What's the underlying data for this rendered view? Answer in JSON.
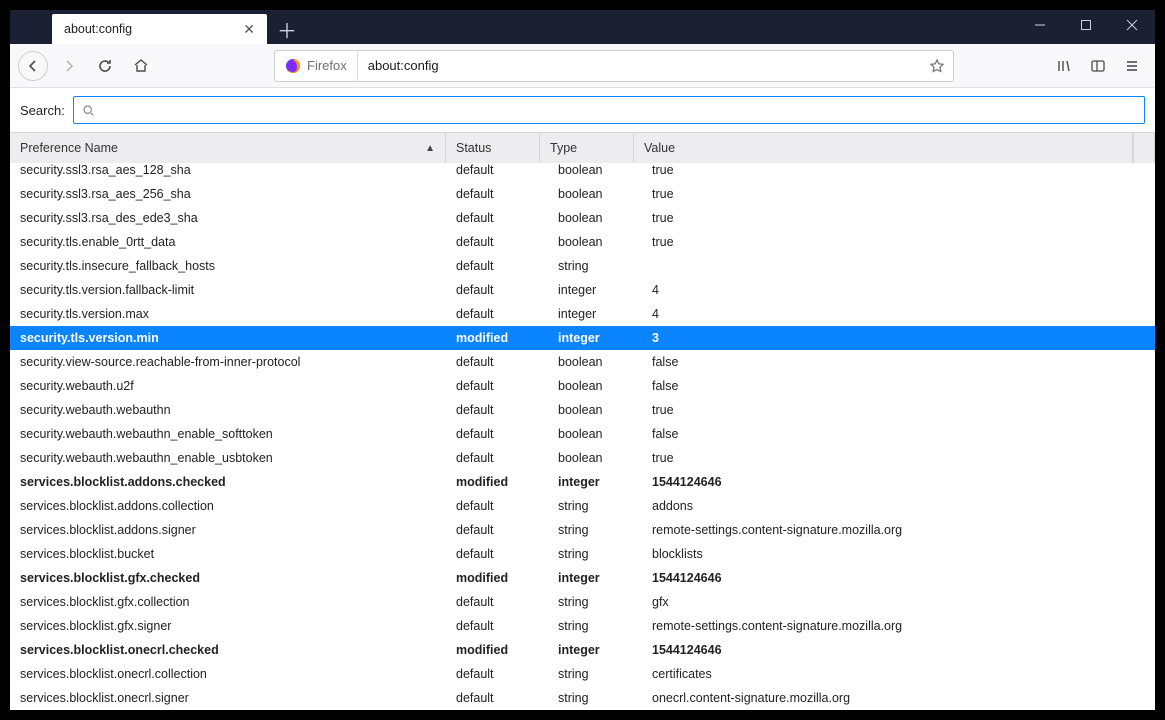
{
  "tab": {
    "title": "about:config"
  },
  "urlbar": {
    "brand_label": "Firefox",
    "url": "about:config"
  },
  "searchrow": {
    "label": "Search:",
    "value": "",
    "placeholder": ""
  },
  "columns": {
    "name": "Preference Name",
    "status": "Status",
    "type": "Type",
    "value": "Value"
  },
  "rows": [
    {
      "name": "security.ssl3.rsa_aes_128_sha",
      "status": "default",
      "type": "boolean",
      "value": "true",
      "modified": false,
      "selected": false
    },
    {
      "name": "security.ssl3.rsa_aes_256_sha",
      "status": "default",
      "type": "boolean",
      "value": "true",
      "modified": false,
      "selected": false
    },
    {
      "name": "security.ssl3.rsa_des_ede3_sha",
      "status": "default",
      "type": "boolean",
      "value": "true",
      "modified": false,
      "selected": false
    },
    {
      "name": "security.tls.enable_0rtt_data",
      "status": "default",
      "type": "boolean",
      "value": "true",
      "modified": false,
      "selected": false
    },
    {
      "name": "security.tls.insecure_fallback_hosts",
      "status": "default",
      "type": "string",
      "value": "",
      "modified": false,
      "selected": false
    },
    {
      "name": "security.tls.version.fallback-limit",
      "status": "default",
      "type": "integer",
      "value": "4",
      "modified": false,
      "selected": false
    },
    {
      "name": "security.tls.version.max",
      "status": "default",
      "type": "integer",
      "value": "4",
      "modified": false,
      "selected": false
    },
    {
      "name": "security.tls.version.min",
      "status": "modified",
      "type": "integer",
      "value": "3",
      "modified": true,
      "selected": true
    },
    {
      "name": "security.view-source.reachable-from-inner-protocol",
      "status": "default",
      "type": "boolean",
      "value": "false",
      "modified": false,
      "selected": false
    },
    {
      "name": "security.webauth.u2f",
      "status": "default",
      "type": "boolean",
      "value": "false",
      "modified": false,
      "selected": false
    },
    {
      "name": "security.webauth.webauthn",
      "status": "default",
      "type": "boolean",
      "value": "true",
      "modified": false,
      "selected": false
    },
    {
      "name": "security.webauth.webauthn_enable_softtoken",
      "status": "default",
      "type": "boolean",
      "value": "false",
      "modified": false,
      "selected": false
    },
    {
      "name": "security.webauth.webauthn_enable_usbtoken",
      "status": "default",
      "type": "boolean",
      "value": "true",
      "modified": false,
      "selected": false
    },
    {
      "name": "services.blocklist.addons.checked",
      "status": "modified",
      "type": "integer",
      "value": "1544124646",
      "modified": true,
      "selected": false
    },
    {
      "name": "services.blocklist.addons.collection",
      "status": "default",
      "type": "string",
      "value": "addons",
      "modified": false,
      "selected": false
    },
    {
      "name": "services.blocklist.addons.signer",
      "status": "default",
      "type": "string",
      "value": "remote-settings.content-signature.mozilla.org",
      "modified": false,
      "selected": false
    },
    {
      "name": "services.blocklist.bucket",
      "status": "default",
      "type": "string",
      "value": "blocklists",
      "modified": false,
      "selected": false
    },
    {
      "name": "services.blocklist.gfx.checked",
      "status": "modified",
      "type": "integer",
      "value": "1544124646",
      "modified": true,
      "selected": false
    },
    {
      "name": "services.blocklist.gfx.collection",
      "status": "default",
      "type": "string",
      "value": "gfx",
      "modified": false,
      "selected": false
    },
    {
      "name": "services.blocklist.gfx.signer",
      "status": "default",
      "type": "string",
      "value": "remote-settings.content-signature.mozilla.org",
      "modified": false,
      "selected": false
    },
    {
      "name": "services.blocklist.onecrl.checked",
      "status": "modified",
      "type": "integer",
      "value": "1544124646",
      "modified": true,
      "selected": false
    },
    {
      "name": "services.blocklist.onecrl.collection",
      "status": "default",
      "type": "string",
      "value": "certificates",
      "modified": false,
      "selected": false
    },
    {
      "name": "services.blocklist.onecrl.signer",
      "status": "default",
      "type": "string",
      "value": "onecrl.content-signature.mozilla.org",
      "modified": false,
      "selected": false
    }
  ]
}
